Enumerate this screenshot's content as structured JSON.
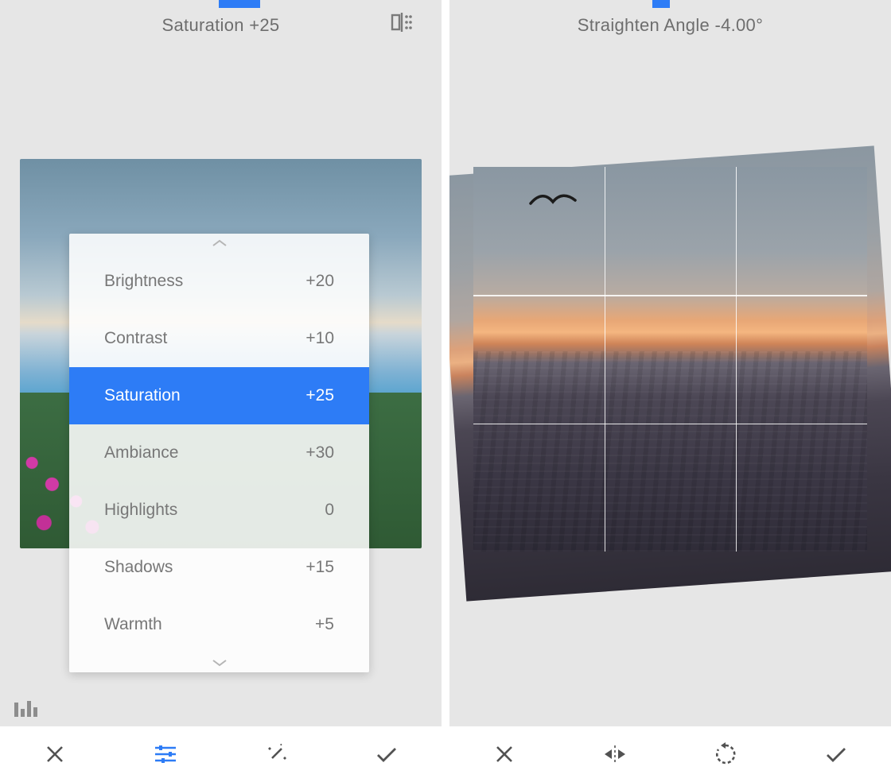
{
  "colors": {
    "accent": "#2d7cf6",
    "text": "#6e6e6e"
  },
  "left": {
    "slider": {
      "start_pct": 49.5,
      "width_pct": 9.5
    },
    "title": "Saturation +25",
    "tune_items": [
      {
        "label": "Brightness",
        "value": "+20",
        "selected": false
      },
      {
        "label": "Contrast",
        "value": "+10",
        "selected": false
      },
      {
        "label": "Saturation",
        "value": "+25",
        "selected": true
      },
      {
        "label": "Ambiance",
        "value": "+30",
        "selected": false
      },
      {
        "label": "Highlights",
        "value": "0",
        "selected": false
      },
      {
        "label": "Shadows",
        "value": "+15",
        "selected": false
      },
      {
        "label": "Warmth",
        "value": "+5",
        "selected": false
      }
    ],
    "toolbar": [
      "close",
      "tune",
      "magic-wand",
      "accept"
    ],
    "active_tool": "tune"
  },
  "right": {
    "slider": {
      "start_pct": 46,
      "width_pct": 4
    },
    "title": "Straighten Angle -4.00°",
    "toolbar": [
      "close",
      "flip",
      "rotate-ccw",
      "accept"
    ],
    "active_tool": null
  }
}
